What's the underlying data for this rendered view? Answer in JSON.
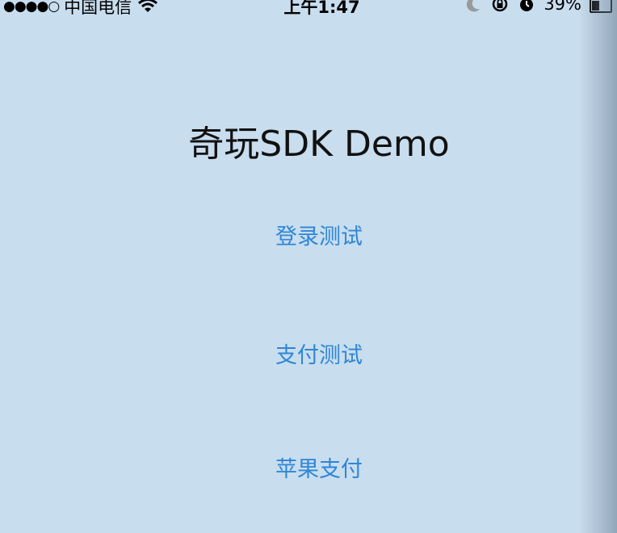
{
  "status_bar": {
    "signal": "●●●●○",
    "carrier": "中国电信",
    "time": "上午1:47",
    "battery_percent": "39%",
    "battery_level": 0.39,
    "icons": [
      "wifi-icon",
      "moon-icon",
      "orientation-lock-icon",
      "alarm-icon",
      "battery-icon"
    ]
  },
  "main": {
    "title": "奇玩SDK Demo",
    "buttons": [
      {
        "label": "登录测试"
      },
      {
        "label": "支付测试"
      },
      {
        "label": "苹果支付"
      }
    ]
  },
  "colors": {
    "background": "#c8ddee",
    "button_text": "#2f86d6",
    "title_text": "#111111"
  }
}
